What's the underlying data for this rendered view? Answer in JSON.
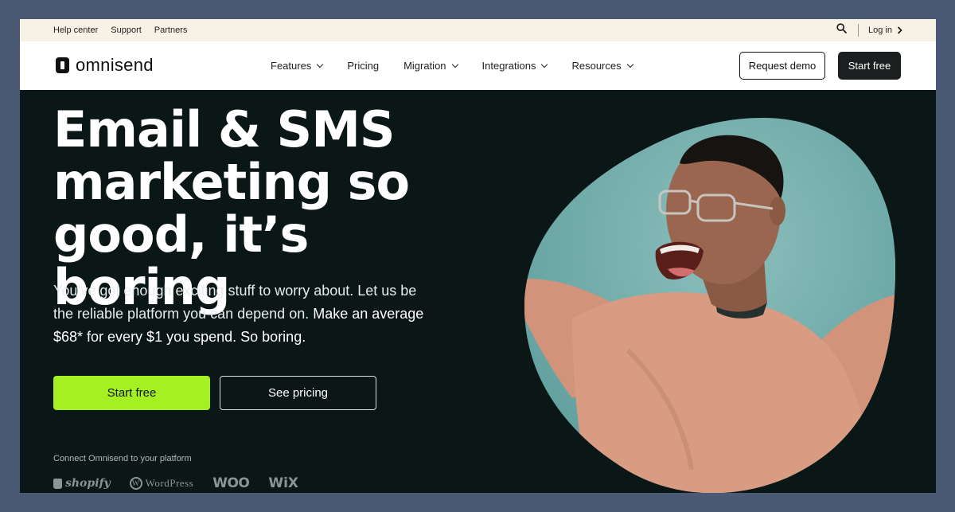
{
  "utility": {
    "links": [
      "Help center",
      "Support",
      "Partners"
    ],
    "login_label": "Log in"
  },
  "nav": {
    "logo_text": "omnisend",
    "menu": [
      "Features",
      "Pricing",
      "Migration",
      "Integrations",
      "Resources"
    ],
    "request_demo_label": "Request demo",
    "start_free_label": "Start free"
  },
  "hero": {
    "headline": [
      "Email & SMS",
      "marketing so",
      "good, it’s boring"
    ],
    "subtext_regular": "You’ve got enough exciting stuff to worry about. Let us be the reliable platform you can depend on.",
    "subtext_strong": "Make an average $68* for every $1 you spend. So boring.",
    "start_free_label": "Start free",
    "see_pricing_label": "See pricing",
    "connect_text": "Connect Omnisend to your platform",
    "platforms": [
      "shopify",
      "WordPress",
      "WOO",
      "WiX"
    ]
  },
  "colors": {
    "accent_green": "#a5f022",
    "hero_bg": "#0b1616",
    "utility_bg": "#f8f1e6",
    "photo_bg": "#6fa9a8",
    "sweater": "#d99c82"
  },
  "icons": {
    "search": "search-icon",
    "login_chevron": "chevron-right-icon",
    "menu_chevron": "chevron-down-icon",
    "logo": "omnisend-logo-icon"
  }
}
